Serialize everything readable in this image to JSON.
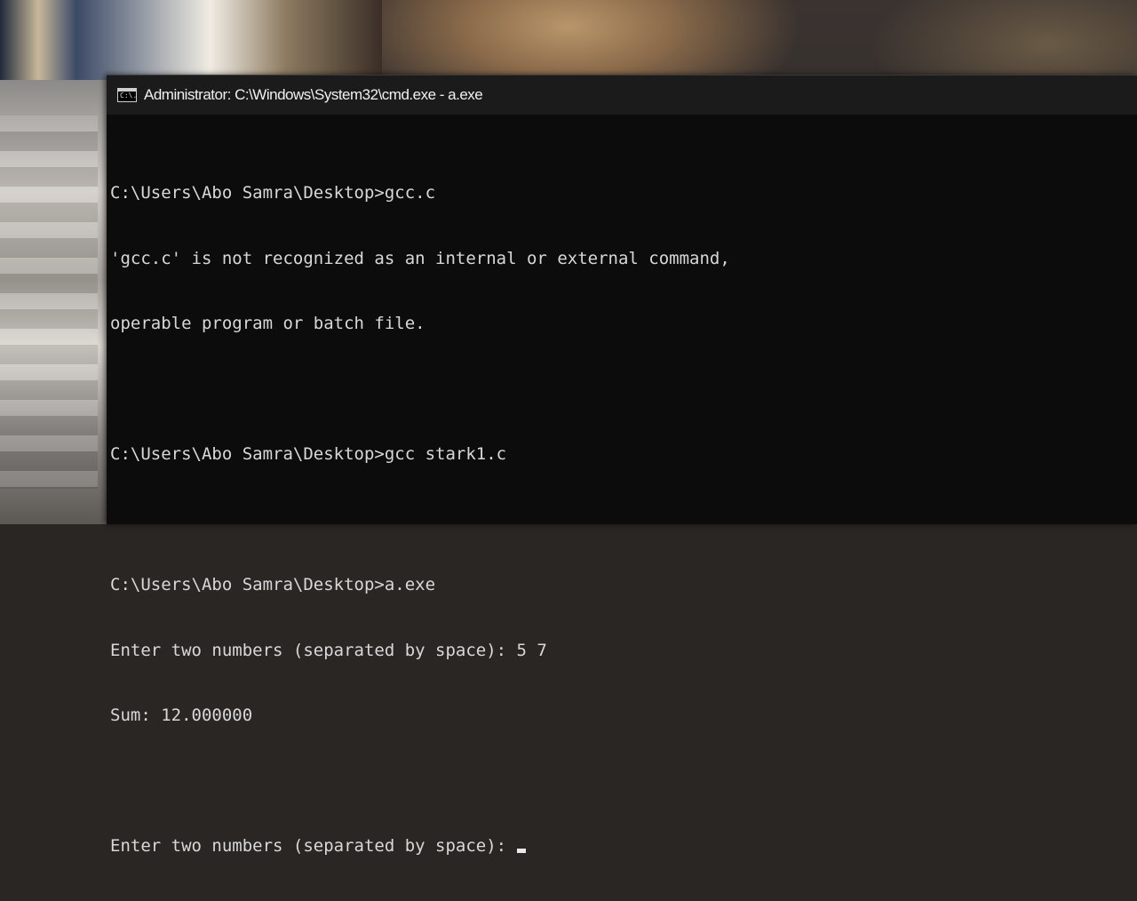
{
  "window": {
    "title": "Administrator: C:\\Windows\\System32\\cmd.exe - a.exe",
    "icon": "cmd-icon",
    "icon_glyph": "C:\\."
  },
  "console": {
    "lines": [
      "C:\\Users\\Abo Samra\\Desktop>gcc.c",
      "'gcc.c' is not recognized as an internal or external command,",
      "operable program or batch file.",
      "",
      "C:\\Users\\Abo Samra\\Desktop>gcc stark1.c",
      "",
      "C:\\Users\\Abo Samra\\Desktop>a.exe",
      "Enter two numbers (separated by space): 5 7",
      "Sum: 12.000000",
      ""
    ],
    "prompt_line": "Enter two numbers (separated by space): "
  },
  "colors": {
    "console_bg": "#0c0c0c",
    "console_text": "#d8d8d8",
    "titlebar_bg": "#1b1b1b"
  }
}
